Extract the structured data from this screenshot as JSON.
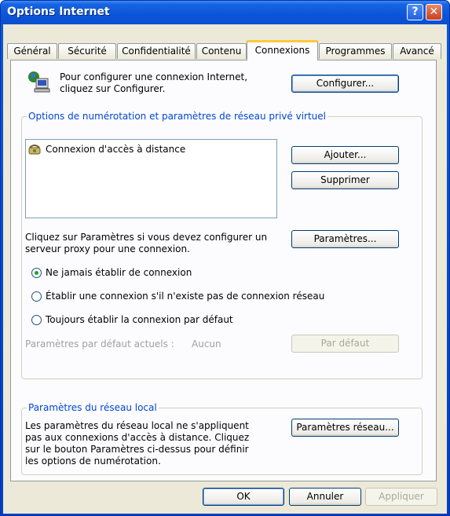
{
  "window": {
    "title": "Options Internet",
    "help_label": "?",
    "close_label": "✕"
  },
  "tabs": [
    {
      "label": "Général"
    },
    {
      "label": "Sécurité"
    },
    {
      "label": "Confidentialité"
    },
    {
      "label": "Contenu"
    },
    {
      "label": "Connexions",
      "active": true
    },
    {
      "label": "Programmes"
    },
    {
      "label": "Avancé"
    }
  ],
  "setup": {
    "icon": "computer-globe-icon",
    "text_line1": "Pour configurer une connexion Internet,",
    "text_line2": "cliquez sur Configurer.",
    "button": "Configurer..."
  },
  "dialup": {
    "legend": "Options de numérotation et paramètres de réseau privé virtuel",
    "connections": [
      {
        "label": "Connexion d'accès à distance",
        "icon": "dialup-phone-icon"
      }
    ],
    "add_button": "Ajouter...",
    "remove_button": "Supprimer",
    "proxy_text_line1": "Cliquez sur Paramètres si vous devez configurer un",
    "proxy_text_line2": "serveur proxy pour une connexion.",
    "settings_button": "Paramètres...",
    "options": [
      {
        "label": "Ne jamais établir de connexion",
        "selected": true
      },
      {
        "label": "Établir une connexion s'il n'existe pas de connexion réseau",
        "selected": false
      },
      {
        "label": "Toujours établir la connexion par défaut",
        "selected": false
      }
    ],
    "current_default_label": "Paramètres par défaut actuels :",
    "current_default_value": "Aucun",
    "default_button": "Par défaut"
  },
  "lan": {
    "legend": "Paramètres du réseau local",
    "text_lines": [
      "Les paramètres du réseau local ne s'appliquent",
      "pas aux connexions d'accès à distance. Cliquez",
      "sur le bouton Paramètres ci-dessus pour définir",
      "les options de numérotation."
    ],
    "button": "Paramètres réseau..."
  },
  "footer": {
    "ok": "OK",
    "cancel": "Annuler",
    "apply": "Appliquer"
  },
  "colors": {
    "title_blue": "#0b55d8",
    "face": "#ece9d8",
    "group_legend": "#0046d5",
    "tab_highlight": "#ffc83c"
  }
}
